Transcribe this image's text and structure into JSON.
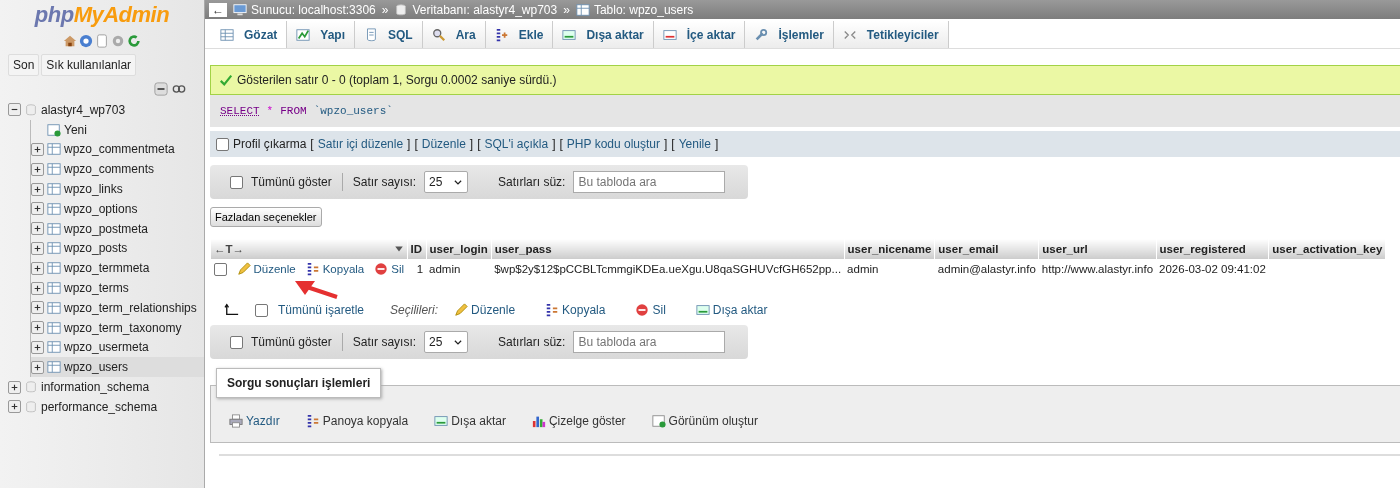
{
  "sidebar": {
    "logo": {
      "part1": "php",
      "part2": "MyAdmin"
    },
    "buttons": [
      "Son",
      "Sık kullanılanlar"
    ],
    "tree": [
      {
        "label": "alastyr4_wp703",
        "kind": "database",
        "expanded": true,
        "children": [
          {
            "label": "Yeni",
            "kind": "new",
            "selected": false
          },
          {
            "label": "wpzo_commentmeta",
            "kind": "table",
            "selected": false
          },
          {
            "label": "wpzo_comments",
            "kind": "table",
            "selected": false
          },
          {
            "label": "wpzo_links",
            "kind": "table",
            "selected": false
          },
          {
            "label": "wpzo_options",
            "kind": "table",
            "selected": false
          },
          {
            "label": "wpzo_postmeta",
            "kind": "table",
            "selected": false
          },
          {
            "label": "wpzo_posts",
            "kind": "table",
            "selected": false
          },
          {
            "label": "wpzo_termmeta",
            "kind": "table",
            "selected": false
          },
          {
            "label": "wpzo_terms",
            "kind": "table",
            "selected": false
          },
          {
            "label": "wpzo_term_relationships",
            "kind": "table",
            "selected": false
          },
          {
            "label": "wpzo_term_taxonomy",
            "kind": "table",
            "selected": false
          },
          {
            "label": "wpzo_usermeta",
            "kind": "table",
            "selected": false
          },
          {
            "label": "wpzo_users",
            "kind": "table",
            "selected": true
          }
        ]
      },
      {
        "label": "information_schema",
        "kind": "database",
        "expanded": false
      },
      {
        "label": "performance_schema",
        "kind": "database",
        "expanded": false
      }
    ]
  },
  "breadcrumb": {
    "back": "←",
    "separator": "»",
    "items": [
      {
        "kind": "server",
        "label": "Sunucu: localhost:3306"
      },
      {
        "kind": "database",
        "label": "Veritabanı: alastyr4_wp703"
      },
      {
        "kind": "table",
        "label": "Tablo: wpzo_users"
      }
    ]
  },
  "tabs": [
    {
      "kind": "browse",
      "label": "Gözat",
      "selected": true
    },
    {
      "kind": "structure",
      "label": "Yapı",
      "selected": false
    },
    {
      "kind": "sql",
      "label": "SQL",
      "selected": false
    },
    {
      "kind": "search",
      "label": "Ara",
      "selected": false
    },
    {
      "kind": "insert",
      "label": "Ekle",
      "selected": false
    },
    {
      "kind": "export",
      "label": "Dışa aktar",
      "selected": false
    },
    {
      "kind": "import",
      "label": "İçe aktar",
      "selected": false
    },
    {
      "kind": "operations",
      "label": "İşlemler",
      "selected": false
    },
    {
      "kind": "triggers",
      "label": "Tetikleyiciler",
      "selected": false
    }
  ],
  "message": "Gösterilen satır 0 - 0 (toplam 1, Sorgu 0.0002 saniye sürdü.)",
  "sql": [
    {
      "kind": "keyword",
      "text": "SELECT"
    },
    {
      "kind": "operator",
      "text": "*"
    },
    {
      "kind": "keyword",
      "text": "FROM"
    },
    {
      "kind": "identifier",
      "text": "`wpzo_users`"
    }
  ],
  "profiling": {
    "label": "Profil çıkarma",
    "checked": false,
    "open_bracket": "[",
    "close_bracket": "]",
    "links": [
      "Satır içi düzenle",
      "Düzenle",
      "SQL'i açıkla",
      "PHP kodu oluştur",
      "Yenile"
    ]
  },
  "navigation": [
    {
      "show_all": "Tümünü göster",
      "checked": false,
      "rows_label": "Satır sayısı:",
      "rows_value": "25",
      "filter_label": "Satırları süz:",
      "filter_placeholder": "Bu tabloda ara"
    },
    {
      "show_all": "Tümünü göster",
      "checked": false,
      "rows_label": "Satır sayısı:",
      "rows_value": "25",
      "filter_label": "Satırları süz:",
      "filter_placeholder": "Bu tabloda ara"
    }
  ],
  "more_options": "Fazladan seçenekler",
  "table": {
    "column_controls": "←T→",
    "columns": [
      "ID",
      "user_login",
      "user_pass",
      "user_nicename",
      "user_email",
      "user_url",
      "user_registered",
      "user_activation_key"
    ],
    "rows": [
      {
        "checked": false,
        "actions": [
          {
            "kind": "edit",
            "label": "Düzenle"
          },
          {
            "kind": "copy",
            "label": "Kopyala"
          },
          {
            "kind": "delete",
            "label": "Sil"
          }
        ],
        "cells": [
          "1",
          "admin",
          "$wp$2y$12$pCCBLTcmmgiKDEa.ueXgu.U8qaSGHUVcfGH652pp...",
          "admin",
          "admin@alastyr.info",
          "http://www.alastyr.info",
          "2026-03-02 09:41:02"
        ]
      }
    ]
  },
  "bulk": {
    "check_all": "Tümünü işaretle",
    "checked": false,
    "with_selected": "Seçilileri:",
    "actions": [
      {
        "kind": "edit",
        "label": "Düzenle"
      },
      {
        "kind": "copy",
        "label": "Kopyala"
      },
      {
        "kind": "delete",
        "label": "Sil"
      },
      {
        "kind": "export",
        "label": "Dışa aktar"
      }
    ]
  },
  "operations": {
    "legend": "Sorgu sonuçları işlemleri",
    "actions": [
      {
        "kind": "print",
        "label": "Yazdır"
      },
      {
        "kind": "copy",
        "label": "Panoya kopyala"
      },
      {
        "kind": "export",
        "label": "Dışa aktar"
      },
      {
        "kind": "chart",
        "label": "Çizelge göster"
      },
      {
        "kind": "view",
        "label": "Görünüm oluştur"
      }
    ]
  },
  "annotation": {
    "kind": "arrow"
  }
}
